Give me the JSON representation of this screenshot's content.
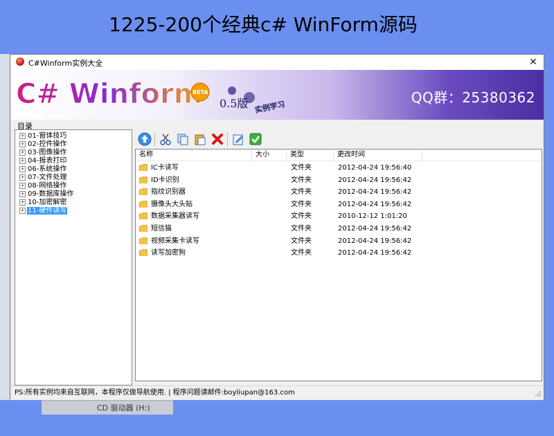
{
  "page_title": "1225-200个经典c# WinForm源码",
  "window": {
    "title": "C#Winform实例大全",
    "close_glyph": "✕"
  },
  "banner": {
    "logo_text": "C# Winform",
    "beta": "BETA",
    "version": "0.5版",
    "subtitle": "实例学习",
    "qq": "QQ群：25380362"
  },
  "tree": {
    "label": "目录",
    "items": [
      {
        "label": "01-窗体技巧",
        "expander": "+"
      },
      {
        "label": "02-控件操作",
        "expander": "+"
      },
      {
        "label": "03-图像操作",
        "expander": "+"
      },
      {
        "label": "04-报表打印",
        "expander": "+"
      },
      {
        "label": "06-系统操作",
        "expander": "+"
      },
      {
        "label": "07-文件处理",
        "expander": "+"
      },
      {
        "label": "08-网络操作",
        "expander": "+"
      },
      {
        "label": "09-数据库操作",
        "expander": "+"
      },
      {
        "label": "10-加密解密",
        "expander": "+"
      },
      {
        "label": "11-硬件读写",
        "expander": "+"
      }
    ],
    "selected_index": 9
  },
  "toolbar": {
    "buttons": [
      "up-arrow-icon",
      "cut-icon",
      "copy-icon",
      "paste-icon",
      "delete-icon",
      "edit-icon",
      "ok-icon"
    ]
  },
  "list": {
    "columns": [
      "名称",
      "大小",
      "类型",
      "更改时间"
    ],
    "rows": [
      {
        "name": "IC卡读写",
        "size": "",
        "type": "文件夹",
        "modified": "2012-04-24 19:56:40"
      },
      {
        "name": "ID卡识别",
        "size": "",
        "type": "文件夹",
        "modified": "2012-04-24 19:56:42"
      },
      {
        "name": "指纹识别器",
        "size": "",
        "type": "文件夹",
        "modified": "2012-04-24 19:56:42"
      },
      {
        "name": "摄像头大头贴",
        "size": "",
        "type": "文件夹",
        "modified": "2012-04-24 19:56:42"
      },
      {
        "name": "数据采集器读写",
        "size": "",
        "type": "文件夹",
        "modified": "2010-12-12 1:01:20"
      },
      {
        "name": "短信猫",
        "size": "",
        "type": "文件夹",
        "modified": "2012-04-24 19:56:42"
      },
      {
        "name": "视频采集卡读写",
        "size": "",
        "type": "文件夹",
        "modified": "2012-04-24 19:56:42"
      },
      {
        "name": "读写加密狗",
        "size": "",
        "type": "文件夹",
        "modified": "2012-04-24 19:56:42"
      }
    ]
  },
  "statusbar": {
    "text": "PS:所有实例均来自互联网，本程序仅做导航使用.  |  程序问题请邮件:boyliupan@163.com"
  },
  "background_peek": {
    "taskbar_text": "CD 驱动器 (H:)"
  },
  "colors": {
    "page_bg": "#6b8ff0",
    "selection": "#3399ff",
    "banner_purple": "#4a2fa2"
  }
}
